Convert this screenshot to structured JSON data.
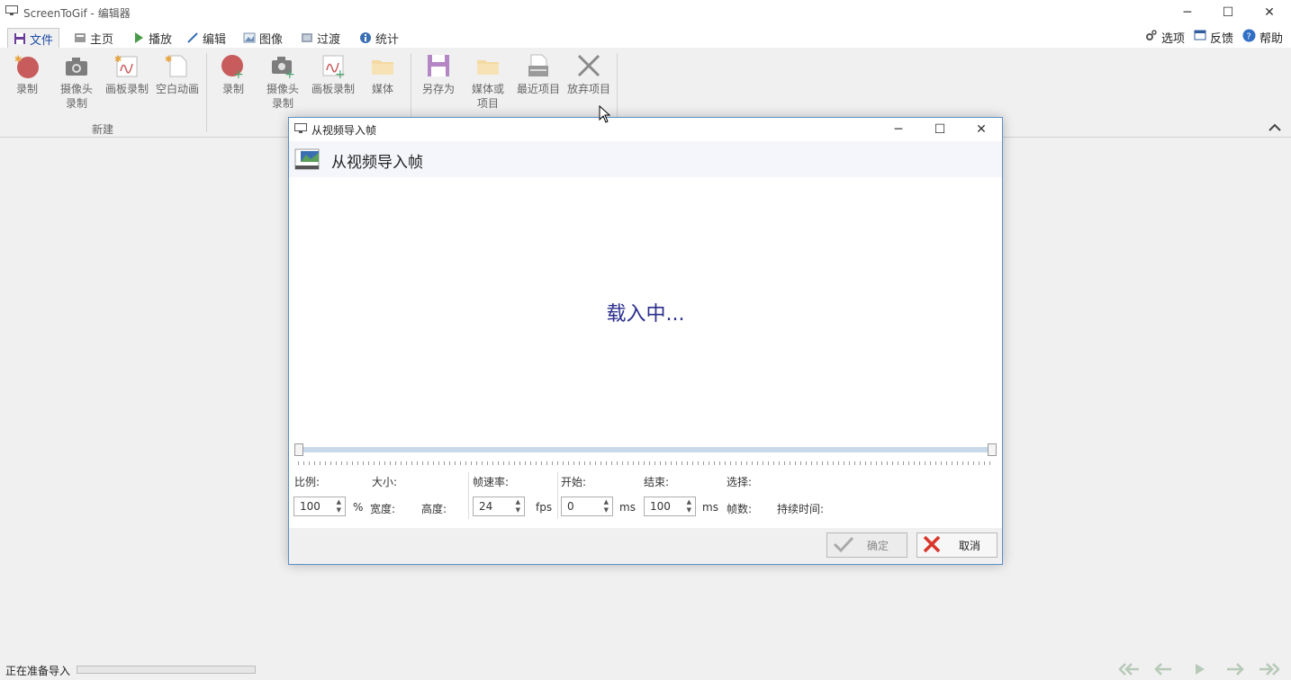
{
  "window": {
    "title": "ScreenToGif - 编辑器"
  },
  "tabs": [
    {
      "label": "文件",
      "icon": "save-icon",
      "active": true
    },
    {
      "label": "主页",
      "icon": "home-icon"
    },
    {
      "label": "播放",
      "icon": "play-icon"
    },
    {
      "label": "编辑",
      "icon": "pencil-icon"
    },
    {
      "label": "图像",
      "icon": "image-icon"
    },
    {
      "label": "过渡",
      "icon": "transition-icon"
    },
    {
      "label": "统计",
      "icon": "info-icon"
    }
  ],
  "top_right": {
    "options": "选项",
    "feedback": "反馈",
    "help": "帮助"
  },
  "ribbon": {
    "new_group": {
      "label": "新建",
      "record": "录制",
      "webcam": "摄像头录制",
      "webcam_l1": "摄像头",
      "webcam_l2": "录制",
      "board": "画板录制",
      "blank": "空白动画"
    },
    "insert_group": {
      "record": "录制",
      "webcam_l1": "摄像头",
      "webcam_l2": "录制",
      "board": "画板录制",
      "media": "媒体"
    },
    "file_group": {
      "save_as": "另存为",
      "media_l1": "媒体或",
      "media_l2": "项目",
      "recent": "最近项目",
      "discard": "放弃项目"
    }
  },
  "dialog": {
    "title": "从视频导入帧",
    "header": "从视频导入帧",
    "loading": "载入中...",
    "labels": {
      "scale": "比例:",
      "size": "大小:",
      "width": "宽度:",
      "height": "高度:",
      "fps_label": "帧速率:",
      "start": "开始:",
      "end": "结束:",
      "selection": "选择:",
      "frames": "帧数:",
      "duration": "持续时间:"
    },
    "units": {
      "percent": "%",
      "fps": "fps",
      "ms1": "ms",
      "ms2": "ms"
    },
    "values": {
      "scale": "100",
      "fps": "24",
      "start": "0",
      "end": "100"
    },
    "buttons": {
      "ok": "确定",
      "cancel": "取消"
    }
  },
  "status": {
    "text": "正在准备导入"
  },
  "colors": {
    "accent": "#1c4ba6",
    "loading": "#2b2e8c",
    "dialog_border": "#5c8fc7",
    "cancel_red": "#d9352b",
    "record_red": "#c85c5c"
  }
}
